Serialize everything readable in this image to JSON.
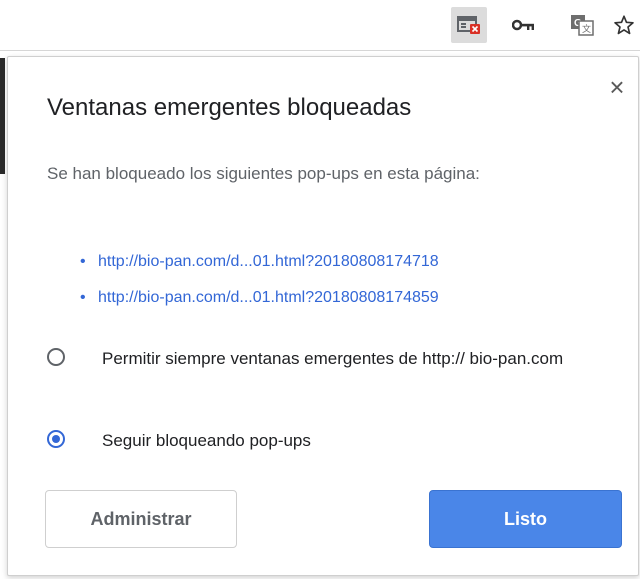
{
  "toolbar": {
    "icons": [
      "popup-blocked-icon",
      "key-icon",
      "translate-icon",
      "star-icon"
    ],
    "accent_blocked": "#d93025"
  },
  "dialog": {
    "title": "Ventanas emergentes bloqueadas",
    "close_symbol": "×",
    "description": "Se han bloqueado los siguientes pop-ups en esta página:",
    "blocked_links": [
      "http://bio-pan.com/d...01.html?20180808174718",
      "http://bio-pan.com/d...01.html?20180808174859"
    ],
    "options": [
      {
        "label": "Permitir siempre ventanas emergentes de http:// bio-pan.com",
        "selected": false
      },
      {
        "label": "Seguir bloqueando pop-ups",
        "selected": true
      }
    ],
    "manage_button": "Administrar",
    "done_button": "Listo"
  },
  "colors": {
    "link": "#3367d6",
    "primary_button": "#4a86e8",
    "radio_selected": "#3367d6"
  }
}
